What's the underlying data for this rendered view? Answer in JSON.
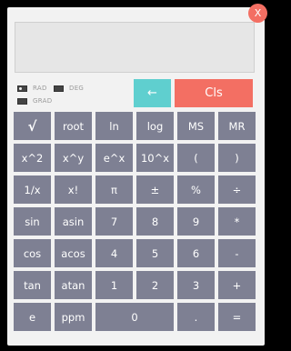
{
  "window": {
    "close_label": "X"
  },
  "display": {
    "value": ""
  },
  "angle_modes": {
    "rad": "RAD",
    "deg": "DEG",
    "grad": "GRAD",
    "selected": "RAD"
  },
  "controls": {
    "backspace_label": "←",
    "clear_label": "Cls"
  },
  "keys": [
    {
      "label": "√",
      "name": "sqrt-button",
      "style": "big"
    },
    {
      "label": "root",
      "name": "root-button"
    },
    {
      "label": "ln",
      "name": "ln-button"
    },
    {
      "label": "log",
      "name": "log-button"
    },
    {
      "label": "MS",
      "name": "memory-store-button"
    },
    {
      "label": "MR",
      "name": "memory-recall-button"
    },
    {
      "label": "x^2",
      "name": "square-button"
    },
    {
      "label": "x^y",
      "name": "power-button"
    },
    {
      "label": "e^x",
      "name": "exp-button"
    },
    {
      "label": "10^x",
      "name": "ten-power-button"
    },
    {
      "label": "(",
      "name": "open-paren-button"
    },
    {
      "label": ")",
      "name": "close-paren-button"
    },
    {
      "label": "1/x",
      "name": "reciprocal-button"
    },
    {
      "label": "x!",
      "name": "factorial-button"
    },
    {
      "label": "π",
      "name": "pi-button"
    },
    {
      "label": "±",
      "name": "plus-minus-button"
    },
    {
      "label": "%",
      "name": "percent-button"
    },
    {
      "label": "÷",
      "name": "divide-button"
    },
    {
      "label": "sin",
      "name": "sin-button"
    },
    {
      "label": "asin",
      "name": "asin-button"
    },
    {
      "label": "7",
      "name": "digit-7-button"
    },
    {
      "label": "8",
      "name": "digit-8-button"
    },
    {
      "label": "9",
      "name": "digit-9-button"
    },
    {
      "label": "*",
      "name": "multiply-button"
    },
    {
      "label": "cos",
      "name": "cos-button"
    },
    {
      "label": "acos",
      "name": "acos-button"
    },
    {
      "label": "4",
      "name": "digit-4-button"
    },
    {
      "label": "5",
      "name": "digit-5-button"
    },
    {
      "label": "6",
      "name": "digit-6-button"
    },
    {
      "label": "-",
      "name": "subtract-button"
    },
    {
      "label": "tan",
      "name": "tan-button"
    },
    {
      "label": "atan",
      "name": "atan-button"
    },
    {
      "label": "1",
      "name": "digit-1-button"
    },
    {
      "label": "2",
      "name": "digit-2-button"
    },
    {
      "label": "3",
      "name": "digit-3-button"
    },
    {
      "label": "+",
      "name": "add-button"
    },
    {
      "label": "e",
      "name": "euler-button"
    },
    {
      "label": "ppm",
      "name": "ppm-button"
    },
    {
      "label": "0",
      "name": "digit-0-button",
      "style": "wide"
    },
    {
      "label": ".",
      "name": "decimal-button"
    },
    {
      "label": "=",
      "name": "equals-button"
    }
  ],
  "colors": {
    "key": "#7e8093",
    "backspace": "#5fcfcf",
    "clear": "#f36f63",
    "close": "#f36f63",
    "panel": "#f2f2f2"
  }
}
